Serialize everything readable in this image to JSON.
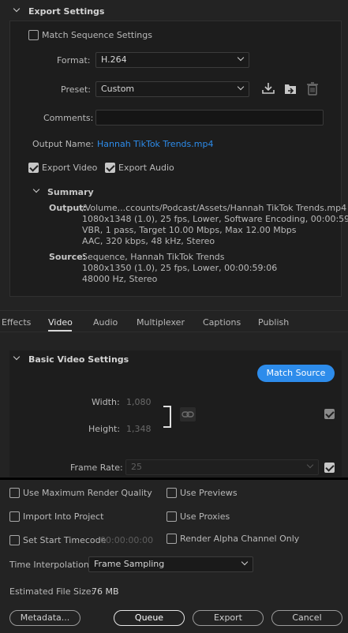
{
  "export_settings": {
    "title": "Export Settings",
    "match_sequence": {
      "label": "Match Sequence Settings",
      "checked": false
    },
    "format": {
      "label": "Format:",
      "value": "H.264"
    },
    "preset": {
      "label": "Preset:",
      "value": "Custom"
    },
    "comments": {
      "label": "Comments:",
      "value": ""
    },
    "output_name": {
      "label": "Output Name:",
      "value": "Hannah TikTok Trends.mp4"
    },
    "export_video": {
      "label": "Export Video",
      "checked": true
    },
    "export_audio": {
      "label": "Export Audio",
      "checked": true
    },
    "summary": {
      "title": "Summary",
      "output_label": "Output:",
      "output_lines": [
        "/Volume...ccounts/Podcast/Assets/Hannah TikTok Trends.mp4",
        "1080x1348 (1.0), 25 fps, Lower, Software Encoding, 00:00:59...",
        "VBR, 1 pass, Target 10.00 Mbps, Max 12.00 Mbps",
        "AAC, 320 kbps, 48 kHz, Stereo"
      ],
      "source_label": "Source:",
      "source_lines": [
        "Sequence, Hannah TikTok Trends",
        "1080x1350 (1.0), 25 fps, Lower, 00:00:59:06",
        "48000 Hz, Stereo"
      ]
    }
  },
  "tabs": [
    "Effects",
    "Video",
    "Audio",
    "Multiplexer",
    "Captions",
    "Publish"
  ],
  "active_tab": "Video",
  "video": {
    "section_title": "Basic Video Settings",
    "match_source_label": "Match Source",
    "width_label": "Width:",
    "width_value": "1,080",
    "height_label": "Height:",
    "height_value": "1,348",
    "frame_rate_label": "Frame Rate:",
    "frame_rate_value": "25"
  },
  "bottom": {
    "max_render_quality": {
      "label": "Use Maximum Render Quality",
      "checked": false
    },
    "use_previews": {
      "label": "Use Previews",
      "checked": false
    },
    "import_into_project": {
      "label": "Import Into Project",
      "checked": false
    },
    "use_proxies": {
      "label": "Use Proxies",
      "checked": false
    },
    "set_start_timecode": {
      "label": "Set Start Timecode",
      "checked": false,
      "value": "00:00:00:00"
    },
    "render_alpha": {
      "label": "Render Alpha Channel Only",
      "checked": false
    },
    "time_interpolation": {
      "label": "Time Interpolation:",
      "value": "Frame Sampling"
    },
    "estimated_size": {
      "label": "Estimated File Size:",
      "value": "76 MB"
    }
  },
  "buttons": {
    "metadata": "Metadata...",
    "queue": "Queue",
    "export": "Export",
    "cancel": "Cancel"
  },
  "colors": {
    "accent": "#2d8ceb",
    "link": "#2d8ceb",
    "background": "#232323"
  }
}
